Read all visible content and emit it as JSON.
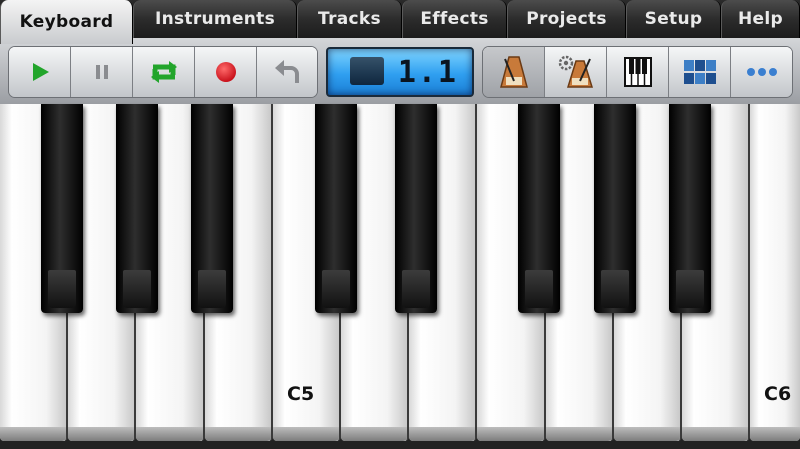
{
  "tabs": [
    {
      "label": "Keyboard",
      "active": true
    },
    {
      "label": "Instruments",
      "active": false
    },
    {
      "label": "Tracks",
      "active": false
    },
    {
      "label": "Effects",
      "active": false
    },
    {
      "label": "Projects",
      "active": false
    },
    {
      "label": "Setup",
      "active": false
    },
    {
      "label": "Help",
      "active": false
    }
  ],
  "transport": {
    "buttons": [
      "play-icon",
      "pause-icon",
      "loop-icon",
      "record-icon",
      "undo-icon"
    ],
    "colors": {
      "play": "#22a52b",
      "loop": "#22a52b",
      "record": "#e0202a",
      "disabled": "#8a8c90"
    }
  },
  "display": {
    "position": "1.1",
    "accent": "#2f9ff0"
  },
  "tools": [
    "metronome-icon",
    "metronome-settings-icon",
    "keyboard-icon",
    "pads-icon",
    "more-icon"
  ],
  "keyboard": {
    "labels": {
      "c5": "C5",
      "c6": "C6"
    }
  }
}
